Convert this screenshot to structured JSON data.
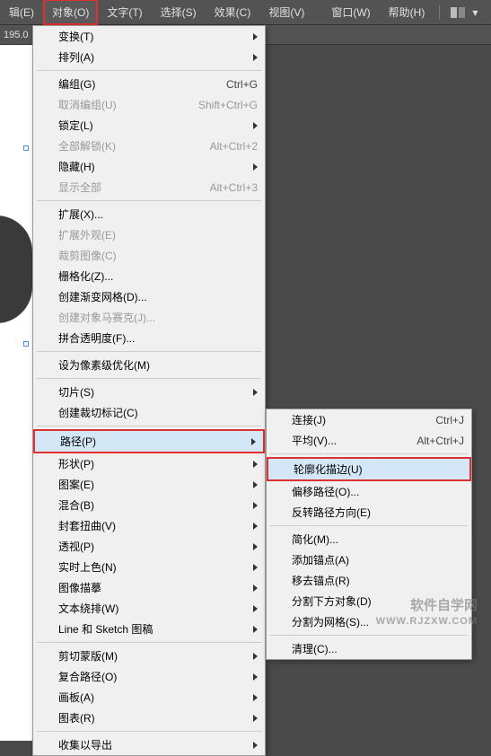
{
  "menubar": {
    "items": [
      {
        "label": "辑(E)"
      },
      {
        "label": "对象(O)"
      },
      {
        "label": "文字(T)"
      },
      {
        "label": "选择(S)"
      },
      {
        "label": "效果(C)"
      },
      {
        "label": "视图(V)"
      },
      {
        "label": "窗口(W)"
      },
      {
        "label": "帮助(H)"
      }
    ]
  },
  "toolbar": {
    "value": "195.0"
  },
  "main_menu": [
    {
      "type": "item",
      "label": "变换(T)",
      "arrow": true
    },
    {
      "type": "item",
      "label": "排列(A)",
      "arrow": true
    },
    {
      "type": "sep"
    },
    {
      "type": "item",
      "label": "编组(G)",
      "shortcut": "Ctrl+G"
    },
    {
      "type": "item",
      "label": "取消编组(U)",
      "shortcut": "Shift+Ctrl+G",
      "disabled": true
    },
    {
      "type": "item",
      "label": "锁定(L)",
      "arrow": true
    },
    {
      "type": "item",
      "label": "全部解锁(K)",
      "shortcut": "Alt+Ctrl+2",
      "disabled": true
    },
    {
      "type": "item",
      "label": "隐藏(H)",
      "arrow": true
    },
    {
      "type": "item",
      "label": "显示全部",
      "shortcut": "Alt+Ctrl+3",
      "disabled": true
    },
    {
      "type": "sep"
    },
    {
      "type": "item",
      "label": "扩展(X)..."
    },
    {
      "type": "item",
      "label": "扩展外观(E)",
      "disabled": true
    },
    {
      "type": "item",
      "label": "裁剪图像(C)",
      "disabled": true
    },
    {
      "type": "item",
      "label": "栅格化(Z)..."
    },
    {
      "type": "item",
      "label": "创建渐变网格(D)..."
    },
    {
      "type": "item",
      "label": "创建对象马赛克(J)...",
      "disabled": true
    },
    {
      "type": "item",
      "label": "拼合透明度(F)..."
    },
    {
      "type": "sep"
    },
    {
      "type": "item",
      "label": "设为像素级优化(M)"
    },
    {
      "type": "sep"
    },
    {
      "type": "item",
      "label": "切片(S)",
      "arrow": true
    },
    {
      "type": "item",
      "label": "创建裁切标记(C)"
    },
    {
      "type": "sep"
    },
    {
      "type": "item",
      "label": "路径(P)",
      "arrow": true,
      "highlighted": true,
      "redbox": true
    },
    {
      "type": "item",
      "label": "形状(P)",
      "arrow": true
    },
    {
      "type": "item",
      "label": "图案(E)",
      "arrow": true
    },
    {
      "type": "item",
      "label": "混合(B)",
      "arrow": true
    },
    {
      "type": "item",
      "label": "封套扭曲(V)",
      "arrow": true
    },
    {
      "type": "item",
      "label": "透视(P)",
      "arrow": true
    },
    {
      "type": "item",
      "label": "实时上色(N)",
      "arrow": true
    },
    {
      "type": "item",
      "label": "图像描摹",
      "arrow": true
    },
    {
      "type": "item",
      "label": "文本绕排(W)",
      "arrow": true
    },
    {
      "type": "item",
      "label": "Line 和 Sketch 图稿",
      "arrow": true
    },
    {
      "type": "sep"
    },
    {
      "type": "item",
      "label": "剪切蒙版(M)",
      "arrow": true
    },
    {
      "type": "item",
      "label": "复合路径(O)",
      "arrow": true
    },
    {
      "type": "item",
      "label": "画板(A)",
      "arrow": true
    },
    {
      "type": "item",
      "label": "图表(R)",
      "arrow": true
    },
    {
      "type": "sep"
    },
    {
      "type": "item",
      "label": "收集以导出",
      "arrow": true
    }
  ],
  "sub_menu": [
    {
      "type": "item",
      "label": "连接(J)",
      "shortcut": "Ctrl+J"
    },
    {
      "type": "item",
      "label": "平均(V)...",
      "shortcut": "Alt+Ctrl+J"
    },
    {
      "type": "sep"
    },
    {
      "type": "item",
      "label": "轮廓化描边(U)",
      "highlighted": true,
      "redbox": true
    },
    {
      "type": "item",
      "label": "偏移路径(O)..."
    },
    {
      "type": "item",
      "label": "反转路径方向(E)"
    },
    {
      "type": "sep"
    },
    {
      "type": "item",
      "label": "简化(M)..."
    },
    {
      "type": "item",
      "label": "添加锚点(A)"
    },
    {
      "type": "item",
      "label": "移去锚点(R)"
    },
    {
      "type": "item",
      "label": "分割下方对象(D)"
    },
    {
      "type": "item",
      "label": "分割为网格(S)..."
    },
    {
      "type": "sep"
    },
    {
      "type": "item",
      "label": "清理(C)..."
    }
  ],
  "watermark": {
    "text": "软件自学网",
    "url": "WWW.RJZXW.COM"
  }
}
